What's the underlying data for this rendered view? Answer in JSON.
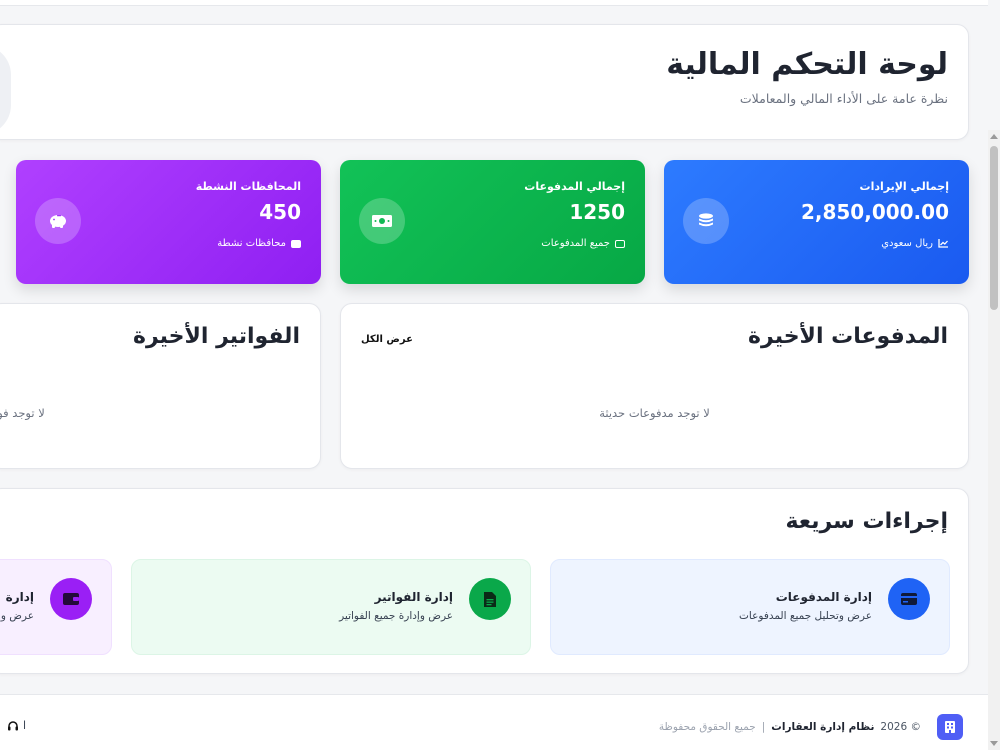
{
  "header": {
    "title": "لوحة التحكم المالية",
    "subtitle": "نظرة عامة على الأداء المالي والمعاملات"
  },
  "stats": [
    {
      "label": "إجمالي الإيرادات",
      "value": "2,850,000.00",
      "footer": "ريال سعودي",
      "icon": "coins-icon",
      "color": "#2563eb"
    },
    {
      "label": "إجمالي المدفوعات",
      "value": "1250",
      "footer": "جميع المدفوعات",
      "icon": "money-bill-icon",
      "color": "#10b94f"
    },
    {
      "label": "المحافظات النشطة",
      "value": "450",
      "footer": "محافظات نشطة",
      "icon": "piggy-bank-icon",
      "color": "#a131fa"
    }
  ],
  "payments_panel": {
    "title": "المدفوعات الأخيرة",
    "view_all": "عرض الكل",
    "empty": "لا توجد مدفوعات حديثة"
  },
  "invoices_panel": {
    "title": "الفواتير الأخيرة",
    "empty": "لا توجد فوا"
  },
  "quick_actions": {
    "title": "إجراءات سريعة",
    "items": [
      {
        "title": "إدارة المدفوعات",
        "desc": "عرض وتحليل جميع المدفوعات",
        "icon": "credit-card-icon"
      },
      {
        "title": "إدارة الفواتير",
        "desc": "عرض وإدارة جميع الفواتير",
        "icon": "invoice-icon"
      },
      {
        "title": "إدارة",
        "desc": "عرض وإدار",
        "icon": "wallet-icon"
      }
    ]
  },
  "footer": {
    "copyright": "© 2026",
    "brand": "نظام إدارة العقارات",
    "separator": "|",
    "rights": "جميع الحقوق محفوظة",
    "left_text": "ا"
  }
}
